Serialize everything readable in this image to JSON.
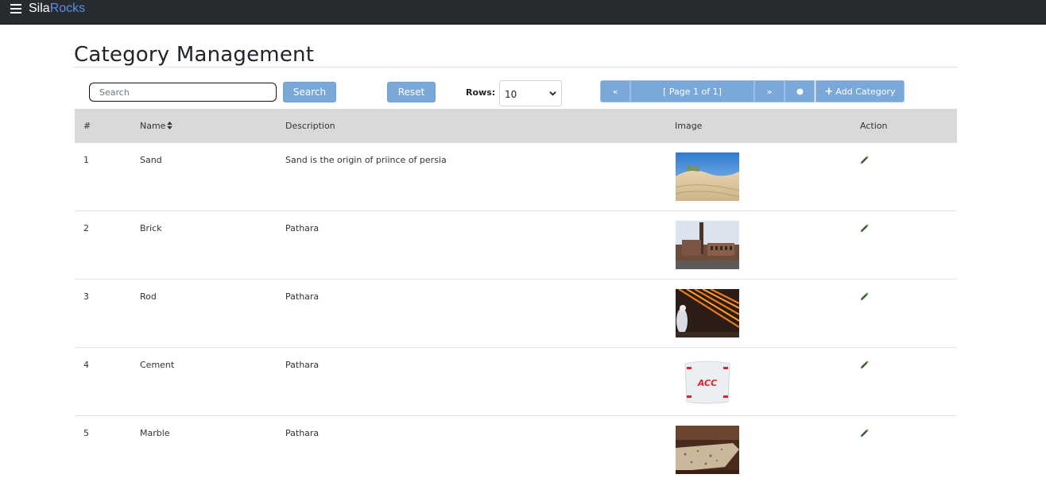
{
  "navbar": {
    "brand_part1": "Sila",
    "brand_part2": "Rocks",
    "brand_color": "#5b8ee6",
    "menu_icon": "hamburger-icon"
  },
  "page": {
    "title": "Category Management"
  },
  "toolbar": {
    "search_placeholder": "Search",
    "search_label": "Search",
    "reset_label": "Reset",
    "rows_label": "Rows:",
    "rows_value": "10",
    "pager_first": "«",
    "pager_info": "[ Page 1 of 1]",
    "pager_next": "»",
    "settings_icon": "gear-icon",
    "add_label": "Add Category",
    "accent_color": "#7aa8d9"
  },
  "table": {
    "columns": [
      "#",
      "Name",
      "Description",
      "Image",
      "Action"
    ],
    "rows": [
      {
        "num": "1",
        "name": "Sand",
        "description": "Sand is the origin of priince of persia",
        "image": "sand-dune-photo"
      },
      {
        "num": "2",
        "name": "Brick",
        "description": "Pathara",
        "image": "brick-factory-photo"
      },
      {
        "num": "3",
        "name": "Rod",
        "description": "Pathara",
        "image": "steel-rod-mill-photo"
      },
      {
        "num": "4",
        "name": "Cement",
        "description": "Pathara",
        "image": "acc-cement-bag-photo"
      },
      {
        "num": "5",
        "name": "Marble",
        "description": "Pathara",
        "image": "marble-kitchen-photo"
      }
    ],
    "action_icon": "pencil-icon"
  }
}
